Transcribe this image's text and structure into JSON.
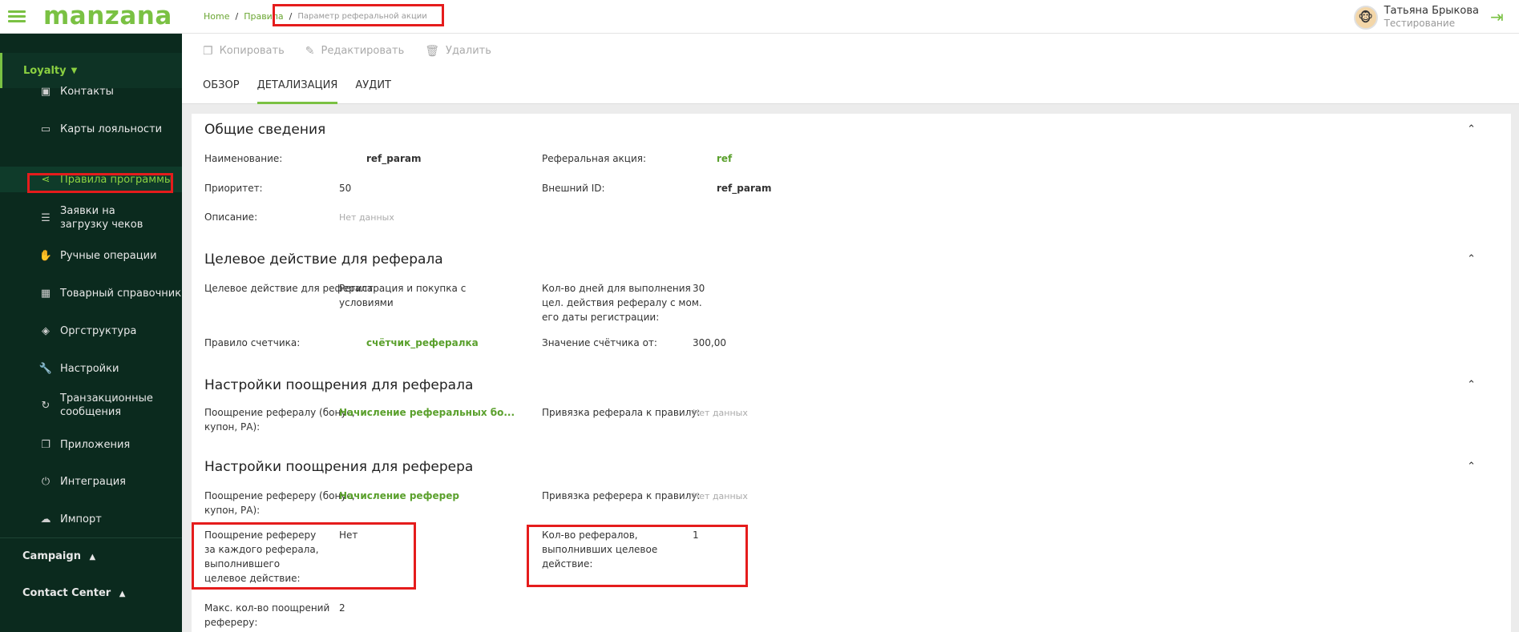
{
  "app": {
    "logo": "manzana"
  },
  "breadcrumb": {
    "home": "Home",
    "rules": "Правила",
    "current": "Параметр реферальной акции",
    "sep": "/"
  },
  "user": {
    "name": "Татьяна Брыкова",
    "role": "Тестирование"
  },
  "sidebar": {
    "section": "Loyalty",
    "items": [
      {
        "label": "Контакты",
        "icon": "contact-card-icon"
      },
      {
        "label": "Карты лояльности",
        "icon": "credit-card-icon"
      },
      {
        "label": "Правила программы",
        "icon": "share-icon"
      },
      {
        "label": "Заявки на загрузку чеков",
        "icon": "receipt-icon"
      },
      {
        "label": "Ручные операции",
        "icon": "hand-icon"
      },
      {
        "label": "Товарный справочник",
        "icon": "grid-icon"
      },
      {
        "label": "Оргструктура",
        "icon": "layers-icon"
      },
      {
        "label": "Настройки",
        "icon": "wrench-icon"
      },
      {
        "label": "Транзакционные сообщения",
        "icon": "sync-icon"
      },
      {
        "label": "Приложения",
        "icon": "files-icon"
      },
      {
        "label": "Интеграция",
        "icon": "plug-icon"
      },
      {
        "label": "Импорт",
        "icon": "cloud-upload-icon"
      }
    ],
    "bottom": [
      "Campaign",
      "Contact Center"
    ]
  },
  "toolbar": {
    "copy": "Копировать",
    "edit": "Редактировать",
    "delete": "Удалить"
  },
  "tabs": [
    "ОБЗОР",
    "ДЕТАЛИЗАЦИЯ",
    "АУДИТ"
  ],
  "sections": {
    "general": {
      "title": "Общие сведения",
      "name_label": "Наименование:",
      "name_value": "ref_param",
      "priority_label": "Приоритет:",
      "priority_value": "50",
      "description_label": "Описание:",
      "description_value": "Нет данных",
      "ref_action_label": "Реферальная акция:",
      "ref_action_value": "ref",
      "external_id_label": "Внешний ID:",
      "external_id_value": "ref_param"
    },
    "target": {
      "title": "Целевое действие для реферала",
      "action_label": "Целевое действие для реферала:",
      "action_value": "Регистрация и покупка с условиями",
      "days_label": "Кол-во дней для выполнения цел. действия рефералу с мом. его даты регистрации:",
      "days_value": "30",
      "counter_rule_label": "Правило счетчика:",
      "counter_rule_value": "счётчик_рефералка",
      "counter_value_label": "Значение счётчика от:",
      "counter_value_value": "300,00"
    },
    "referral_reward": {
      "title": "Настройки поощрения для реферала",
      "reward_label": "Поощрение рефералу (бонус, купон, РА):",
      "reward_value": "Начисление реферальных бо...",
      "binding_label": "Привязка реферала к правилу:",
      "binding_value": "Нет данных"
    },
    "referrer_reward": {
      "title": "Настройки поощрения для реферера",
      "reward_label": "Поощрение рефереру (бонус, купон, РА):",
      "reward_value": "Начисление реферер",
      "binding_label": "Привязка реферера к правилу:",
      "binding_value": "Нет данных",
      "each_label": "Поощрение рефереру за каждого реферала, выполнившего целевое действие:",
      "each_value": "Нет",
      "count_label": "Кол-во рефералов, выполнивших целевое действие:",
      "count_value": "1",
      "max_label": "Макс. кол-во поощрений рефереру:",
      "max_value": "2"
    }
  },
  "colors": {
    "accent": "#7ac143",
    "sidebar_bg": "#0b2a1e",
    "highlight": "#e51c1c"
  }
}
